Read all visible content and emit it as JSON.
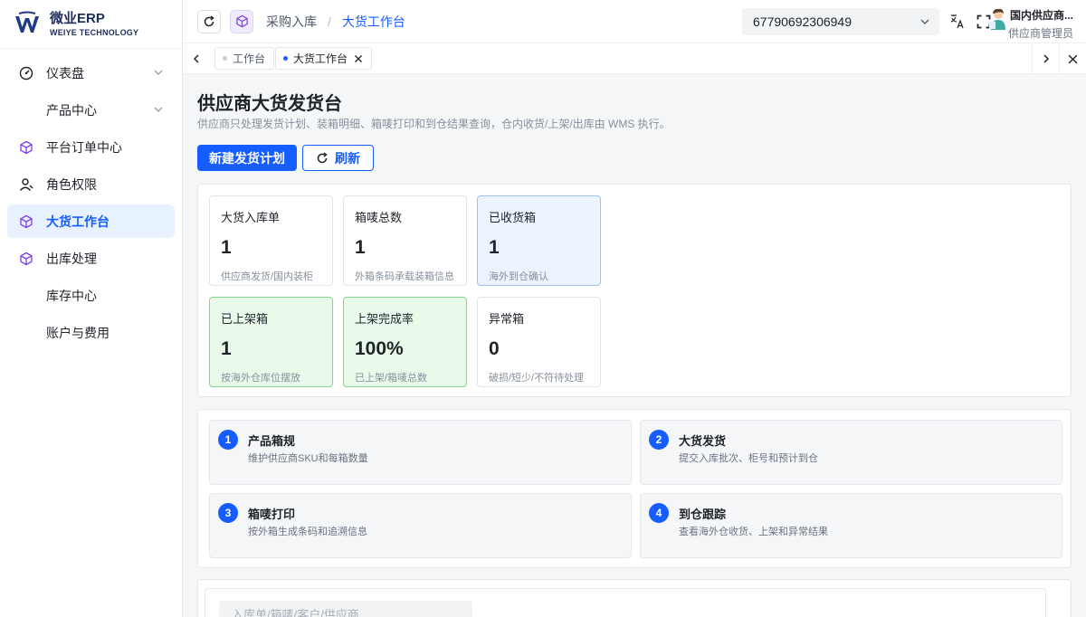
{
  "brand": {
    "name": "微业ERP",
    "subtitle": "WEIYE TECHNOLOGY"
  },
  "sidebar": {
    "items": [
      {
        "label": "仪表盘",
        "icon": "dashboard-icon",
        "expandable": true
      },
      {
        "label": "产品中心",
        "icon": "",
        "expandable": true
      },
      {
        "label": "平台订单中心",
        "icon": "cube-icon"
      },
      {
        "label": "角色权限",
        "icon": "user-icon"
      },
      {
        "label": "大货工作台",
        "icon": "cube-icon",
        "active": true
      },
      {
        "label": "出库处理",
        "icon": "cube-icon"
      },
      {
        "label": "库存中心",
        "icon": ""
      },
      {
        "label": "账户与费用",
        "icon": ""
      }
    ]
  },
  "header": {
    "breadcrumb": [
      "采购入库",
      "大货工作台"
    ],
    "account_select": "67790692306949",
    "user_name": "国内供应商...",
    "user_role": "供应商管理员"
  },
  "tabs": [
    {
      "label": "工作台",
      "active": false
    },
    {
      "label": "大货工作台",
      "active": true
    }
  ],
  "page": {
    "title": "供应商大货发货台",
    "description": "供应商只处理发货计划、装箱明细、箱唛打印和到仓结果查询，仓内收货/上架/出库由 WMS 执行。",
    "primary_button": "新建发货计划",
    "refresh_button": "刷新"
  },
  "stats": [
    {
      "label": "大货入库单",
      "value": "1",
      "note": "供应商发货/国内装柜",
      "tone": "default"
    },
    {
      "label": "箱唛总数",
      "value": "1",
      "note": "外箱条码承载装箱信息",
      "tone": "default"
    },
    {
      "label": "已收货箱",
      "value": "1",
      "note": "海外到仓确认",
      "tone": "blue"
    },
    {
      "label": "已上架箱",
      "value": "1",
      "note": "按海外仓库位摆放",
      "tone": "green"
    },
    {
      "label": "上架完成率",
      "value": "100%",
      "note": "已上架/箱唛总数",
      "tone": "green"
    },
    {
      "label": "异常箱",
      "value": "0",
      "note": "破损/短少/不符待处理",
      "tone": "default"
    }
  ],
  "steps": [
    {
      "num": "1",
      "title": "产品箱规",
      "desc": "维护供应商SKU和每箱数量"
    },
    {
      "num": "2",
      "title": "大货发货",
      "desc": "提交入库批次、柜号和预计到仓"
    },
    {
      "num": "3",
      "title": "箱唛打印",
      "desc": "按外箱生成条码和追溯信息"
    },
    {
      "num": "4",
      "title": "到仓跟踪",
      "desc": "查看海外仓收货、上架和异常结果"
    }
  ],
  "filter": {
    "placeholder": "入库单/箱唛/客户/供应商"
  },
  "colors": {
    "primary": "#165dff",
    "blue_card": "#eaf3fe",
    "green_card": "#eafaea"
  }
}
